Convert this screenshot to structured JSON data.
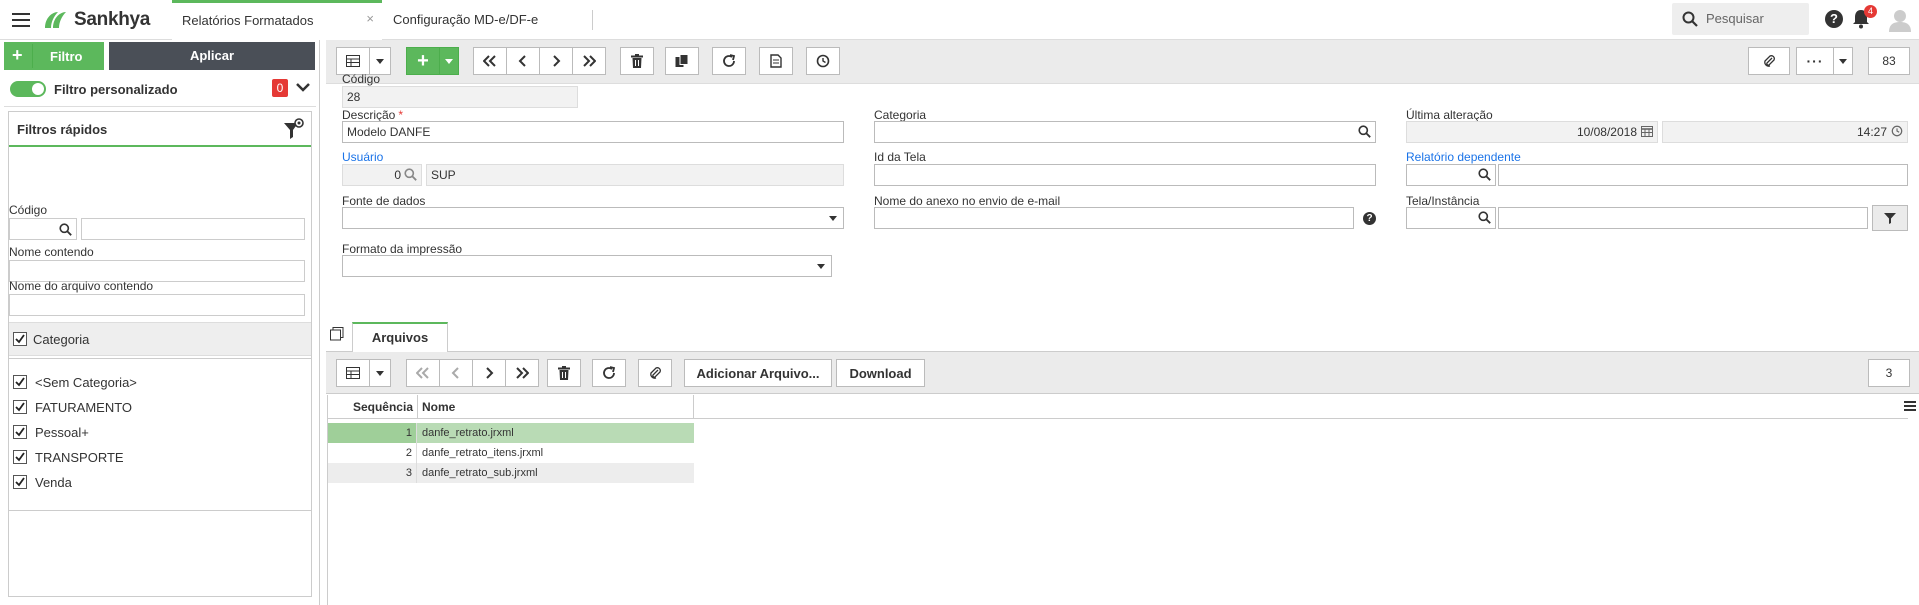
{
  "app": {
    "logo_text": "Sankhya"
  },
  "tabs": [
    {
      "label": "Relatórios Formatados",
      "close": "×"
    },
    {
      "label": "Configuração MD-e/DF-e",
      "close": "×"
    }
  ],
  "header": {
    "search_placeholder": "Pesquisar",
    "help": "?",
    "notif_count": "4"
  },
  "filter": {
    "btn_filtro": "Filtro",
    "btn_aplicar": "Aplicar",
    "custom_label": "Filtro personalizado",
    "custom_count": "0",
    "quick_title": "Filtros rápidos",
    "codigo_label": "Código",
    "nome_label": "Nome contendo",
    "arquivo_label": "Nome do arquivo contendo",
    "categoria_label": "Categoria",
    "categories": [
      "<Sem Categoria>",
      "FATURAMENTO",
      "Pessoal+",
      "TRANSPORTE",
      "Venda"
    ]
  },
  "toolbar": {
    "record_count": "83"
  },
  "form": {
    "codigo_label": "Código",
    "codigo_value": "28",
    "descricao_label": "Descrição",
    "descricao_req": "*",
    "descricao_value": "Modelo DANFE",
    "categoria_label": "Categoria",
    "ultima_label": "Última alteração",
    "ultima_date": "10/08/2018",
    "ultima_time": "14:27",
    "usuario_label": "Usuário",
    "usuario_code": "0",
    "usuario_name": "SUP",
    "idtela_label": "Id da Tela",
    "reldep_label": "Relatório dependente",
    "fonte_label": "Fonte de dados",
    "anexo_label": "Nome do anexo no envio de e-mail",
    "tela_label": "Tela/Instância",
    "formato_label": "Formato da impressão"
  },
  "detail": {
    "tab_label": "Arquivos",
    "add_button": "Adicionar Arquivo...",
    "download_button": "Download",
    "count": "3",
    "col_seq": "Sequência",
    "col_nome": "Nome",
    "rows": [
      {
        "seq": "1",
        "nome": "danfe_retrato.jrxml"
      },
      {
        "seq": "2",
        "nome": "danfe_retrato_itens.jrxml"
      },
      {
        "seq": "3",
        "nome": "danfe_retrato_sub.jrxml"
      }
    ]
  },
  "colors": {
    "accent": "#5cb85c",
    "dark": "#4a4f57",
    "badge": "#e53935",
    "link": "#1a73e8"
  }
}
